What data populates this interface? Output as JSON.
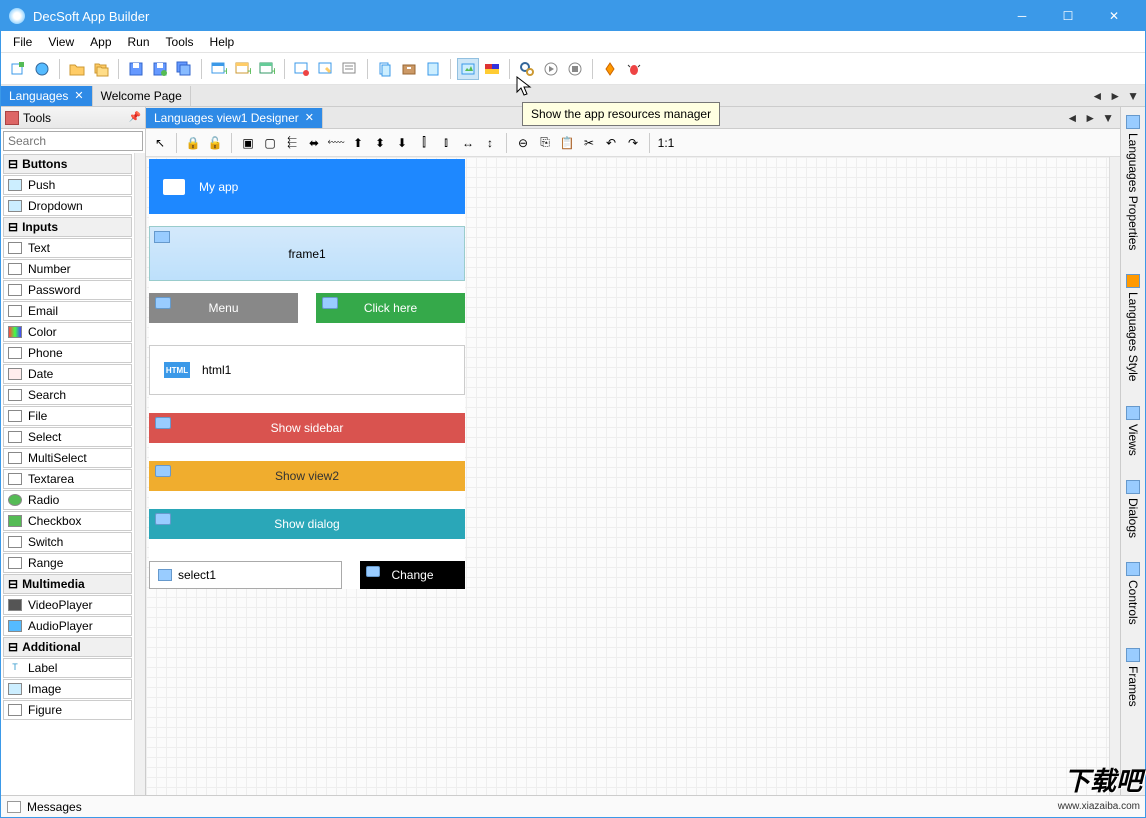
{
  "title": "DecSoft App Builder",
  "menus": [
    "File",
    "View",
    "App",
    "Run",
    "Tools",
    "Help"
  ],
  "tooltip": "Show the app resources manager",
  "tabs": {
    "active": "Languages",
    "other": "Welcome Page"
  },
  "designer_tab": "Languages view1 Designer",
  "tools_header": "Tools",
  "search_placeholder": "Search",
  "tool_categories": {
    "buttons": {
      "label": "Buttons",
      "items": [
        "Push",
        "Dropdown"
      ]
    },
    "inputs": {
      "label": "Inputs",
      "items": [
        "Text",
        "Number",
        "Password",
        "Email",
        "Color",
        "Phone",
        "Date",
        "Search",
        "File",
        "Select",
        "MultiSelect",
        "Textarea",
        "Radio",
        "Checkbox",
        "Switch",
        "Range"
      ]
    },
    "multimedia": {
      "label": "Multimedia",
      "items": [
        "VideoPlayer",
        "AudioPlayer"
      ]
    },
    "additional": {
      "label": "Additional",
      "items": [
        "Label",
        "Image",
        "Figure"
      ]
    }
  },
  "canvas": {
    "app_title": "My app",
    "frame": "frame1",
    "menu_btn": "Menu",
    "click_btn": "Click here",
    "html": "html1",
    "bar_red": "Show sidebar",
    "bar_yellow": "Show view2",
    "bar_teal": "Show dialog",
    "select": "select1",
    "change": "Change"
  },
  "right_panels": [
    "Languages Properties",
    "Languages Style",
    "Views",
    "Dialogs",
    "Controls",
    "Frames"
  ],
  "statusbar": "Messages",
  "watermark": "下载吧",
  "watermark_sub": "www.xiazaiba.com"
}
